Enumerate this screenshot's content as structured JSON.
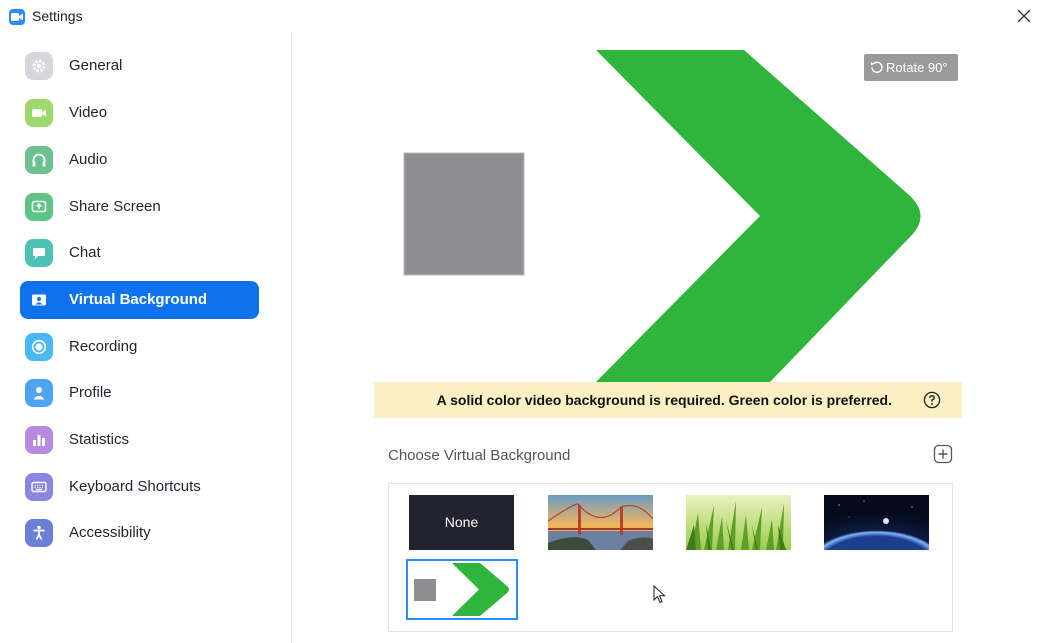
{
  "window": {
    "title": "Settings",
    "app_icon": "zoom-camera-icon",
    "close_icon": "close-icon"
  },
  "sidebar": {
    "items": [
      {
        "label": "General",
        "icon": "gear-icon",
        "color": "#d5d7dc",
        "active": false
      },
      {
        "label": "Video",
        "icon": "video-camera-icon",
        "color": "#9fd96d",
        "active": false
      },
      {
        "label": "Audio",
        "icon": "headphones-icon",
        "color": "#6fc08f",
        "active": false
      },
      {
        "label": "Share Screen",
        "icon": "share-screen-icon",
        "color": "#5ec387",
        "active": false
      },
      {
        "label": "Chat",
        "icon": "chat-bubble-icon",
        "color": "#4ec2b4",
        "active": false
      },
      {
        "label": "Virtual Background",
        "icon": "person-portrait-icon",
        "color": "#0e72ed",
        "active": true
      },
      {
        "label": "Recording",
        "icon": "record-icon",
        "color": "#4ab8f4",
        "active": false
      },
      {
        "label": "Profile",
        "icon": "person-icon",
        "color": "#4ea4f2",
        "active": false
      },
      {
        "label": "Statistics",
        "icon": "bar-chart-icon",
        "color": "#b58ae0",
        "active": false
      },
      {
        "label": "Keyboard Shortcuts",
        "icon": "keyboard-icon",
        "color": "#8a86de",
        "active": false
      },
      {
        "label": "Accessibility",
        "icon": "accessibility-icon",
        "color": "#6c7fd8",
        "active": false
      }
    ]
  },
  "preview": {
    "rotate_label": "Rotate 90°",
    "rotate_icon": "rotate-icon",
    "arrow_color": "#2fb43c",
    "square_color": "#8e8e92"
  },
  "notice": {
    "text": "A solid color video background is required. Green color is preferred.",
    "help_icon": "question-circle-icon",
    "bg_color": "#fbf0c4"
  },
  "gallery": {
    "title": "Choose Virtual Background",
    "add_icon": "plus-square-icon",
    "items": [
      {
        "label": "None",
        "kind": "none"
      },
      {
        "kind": "golden-gate-bridge"
      },
      {
        "kind": "grass"
      },
      {
        "kind": "earth-from-space"
      },
      {
        "kind": "green-arrow-custom",
        "selected": true
      }
    ]
  },
  "accent_color": "#0e72ed"
}
